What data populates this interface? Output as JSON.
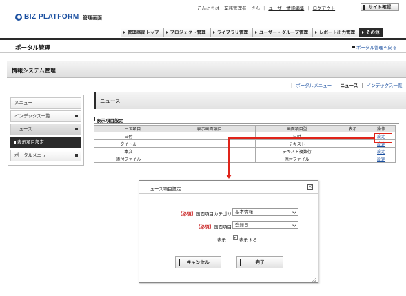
{
  "header": {
    "logo_text": "BIZ PLATFORM",
    "admin_label": "管理画面",
    "greeting": "こんにちは　業務管理者　さん",
    "user_edit_link": "ユーザー情報編集",
    "logout_link": "ログアウト",
    "site_check_button": "サイト確認"
  },
  "top_nav": {
    "tabs": [
      {
        "label": "管理画面トップ",
        "active": false
      },
      {
        "label": "プロジェクト管理",
        "active": false
      },
      {
        "label": "ライブラリ管理",
        "active": false
      },
      {
        "label": "ユーザー・グループ管理",
        "active": false
      },
      {
        "label": "レポート出力管理",
        "active": false
      },
      {
        "label": "その他",
        "active": true
      }
    ]
  },
  "page": {
    "title": "ポータル管理",
    "back_link": "ポータル管理へ戻る",
    "system_title": "情報システム管理"
  },
  "sub_nav": {
    "items": [
      "ポータルメニュー",
      "ニュース",
      "インデックス一覧"
    ]
  },
  "sidebar": {
    "items": [
      {
        "label": "メニュー",
        "style": "plain"
      },
      {
        "label": "インデックス一覧",
        "style": "plain"
      },
      {
        "label": "ニュース",
        "style": "grey"
      },
      {
        "label": "表示項目設定",
        "style": "dark"
      },
      {
        "label": "ポータルメニュー",
        "style": "plain"
      }
    ]
  },
  "content": {
    "section_title": "ニュース",
    "display_items_label": "表示項目設定",
    "table": {
      "headers": [
        "ニュース項目",
        "表示画面項目",
        "画面項目型",
        "表示",
        "操作"
      ],
      "rows": [
        [
          "日付",
          "",
          "日付",
          "",
          "設定"
        ],
        [
          "タイトル",
          "",
          "テキスト",
          "",
          "設定"
        ],
        [
          "本文",
          "",
          "テキスト複数行",
          "",
          "設定"
        ],
        [
          "添付ファイル",
          "",
          "添付ファイル",
          "",
          "設定"
        ]
      ]
    }
  },
  "dialog": {
    "title": "ニュース項目設定",
    "close_icon": "×",
    "required_tag": "【必須】",
    "category_label": "画面項目カテゴリ",
    "category_value": "基本情報",
    "item_label": "画面項目",
    "item_value": "登録日",
    "show_label": "表示",
    "show_checkbox_label": "表示する",
    "show_checked": true,
    "cancel_button": "キャンセル",
    "done_button": "完了"
  },
  "colors": {
    "brand_blue": "#1a4fa0",
    "highlight_red": "#e0241a",
    "dark_tab": "#2a2a2a"
  }
}
